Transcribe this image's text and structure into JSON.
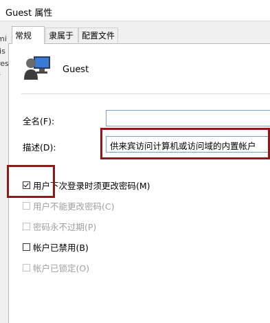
{
  "window": {
    "title": "Guest 属性"
  },
  "left_strip": [
    "mi",
    "lis",
    "res",
    "r"
  ],
  "tabs": [
    {
      "label": "常规",
      "active": true
    },
    {
      "label": "隶属于",
      "active": false
    },
    {
      "label": "配置文件",
      "active": false
    }
  ],
  "user": {
    "name": "Guest",
    "icon": "user-account-icon"
  },
  "fields": {
    "fullname_label": "全名(F):",
    "fullname_value": "",
    "description_label": "描述(D):",
    "description_value": "供来宾访问计算机或访问域的内置帐户"
  },
  "options": [
    {
      "label": "用户下次登录时须更改密码(M)",
      "checked": true,
      "enabled": true
    },
    {
      "label": "用户不能更改密码(C)",
      "checked": false,
      "enabled": false
    },
    {
      "label": "密码永不过期(P)",
      "checked": false,
      "enabled": false
    },
    {
      "label": "帐户已禁用(B)",
      "checked": false,
      "enabled": true
    },
    {
      "label": "帐户已锁定(O)",
      "checked": false,
      "enabled": false
    }
  ],
  "colors": {
    "annotation": "#8b1a1a",
    "input_border": "#7a9cc8",
    "disabled_text": "#a0a0a0"
  }
}
